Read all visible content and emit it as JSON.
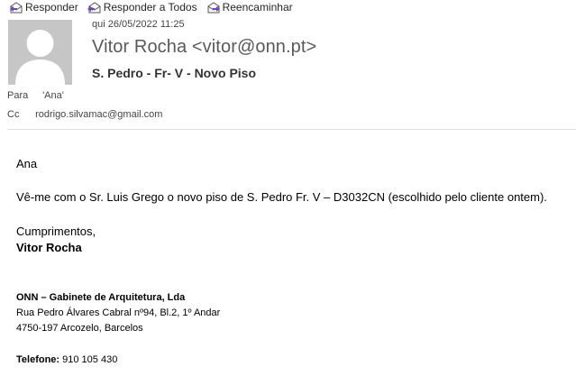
{
  "toolbar": {
    "reply_label": "Responder",
    "reply_all_label": "Responder a Todos",
    "forward_label": "Reencaminhar"
  },
  "message": {
    "datetime": "qui 26/05/2022 11:25",
    "sender": "Vitor Rocha <vitor@onn.pt>",
    "subject": "S. Pedro - Fr- V - Novo Piso",
    "to_label": "Para",
    "to_value": "'Ana'",
    "cc_label": "Cc",
    "cc_value": "rodrigo.silvamac@gmail.com"
  },
  "body": {
    "greeting": "Ana",
    "paragraph": "Vê-me com o Sr. Luis Grego o novo piso de S. Pedro Fr. V – D3032CN (escolhido pelo cliente ontem).",
    "closing": "Cumprimentos,",
    "signer": "Vitor Rocha"
  },
  "signature": {
    "company": "ONN – Gabinete de Arquitetura, Lda",
    "address_line1": "Rua Pedro Álvares Cabral nº94, Bl.2, 1º Andar",
    "address_line2": "4750-197 Arcozelo, Barcelos",
    "phone_label": "Telefone:",
    "phone_value": "910 105 430"
  },
  "colors": {
    "avatar_bg": "#c6c6c6",
    "avatar_fg": "#ffffff",
    "icon_accent": "#6b46c1"
  }
}
